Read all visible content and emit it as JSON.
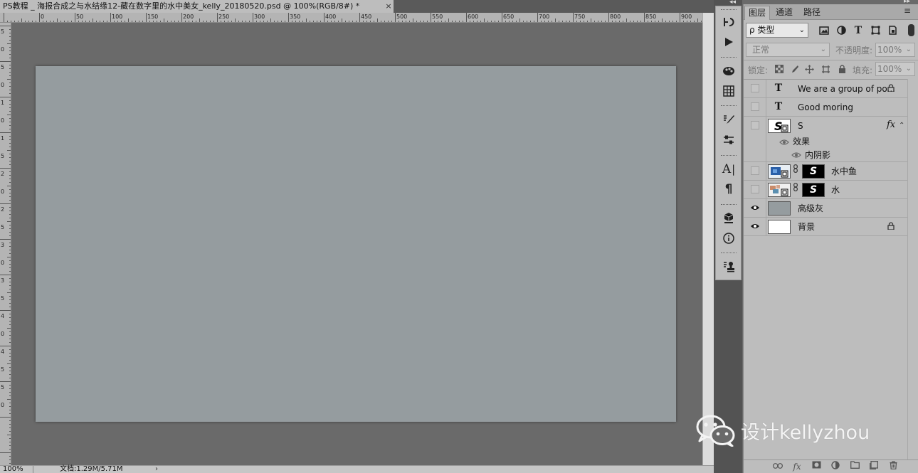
{
  "document": {
    "tab_title": "PS教程 _ 海报合成之与水结缘12-藏在数字里的水中美女_kelly_20180520.psd @ 100%(RGB/8#) *",
    "close": "×"
  },
  "ruler": {
    "top_labels": [
      "0",
      "50",
      "100",
      "150",
      "200",
      "250",
      "300",
      "350",
      "400",
      "450",
      "500",
      "550",
      "600",
      "650",
      "700",
      "750",
      "800",
      "850",
      "900"
    ],
    "left_labels": [
      "5",
      "0",
      "5",
      "0",
      "1",
      "0",
      "1",
      "5",
      "2",
      "0",
      "2",
      "5",
      "3",
      "0",
      "3",
      "5",
      "4",
      "0",
      "4",
      "5",
      "5",
      "0"
    ]
  },
  "status": {
    "zoom": "100%",
    "doc_info": "文档:1.29M/5.71M",
    "arrow": "›"
  },
  "panel": {
    "tabs": [
      "图层",
      "通道",
      "路径"
    ],
    "menu_icon": "≡",
    "filter_kind": "ρ 类型",
    "blend_mode": "正常",
    "opacity_label": "不透明度:",
    "opacity_value": "100%",
    "lock_label": "锁定:",
    "fill_label": "填充:",
    "fill_value": "100%"
  },
  "layers": [
    {
      "name": "We are a group of po...",
      "kind": "text",
      "visible": false,
      "locked": true
    },
    {
      "name": "Good moring",
      "kind": "text",
      "visible": false,
      "locked": false
    },
    {
      "name": "S",
      "kind": "smart",
      "visible": false,
      "locked": false,
      "fx": "fx"
    },
    {
      "name": "效果",
      "kind": "effects-group"
    },
    {
      "name": "内阴影",
      "kind": "effect"
    },
    {
      "name": "水中鱼",
      "kind": "masked",
      "visible": false
    },
    {
      "name": "水",
      "kind": "masked",
      "visible": false
    },
    {
      "name": "高级灰",
      "kind": "fill",
      "visible": true,
      "color": "#959c9f"
    },
    {
      "name": "背景",
      "kind": "background",
      "visible": true,
      "locked": true,
      "color": "#ffffff"
    }
  ],
  "watermark": {
    "text": "设计kellyzhou"
  },
  "colors": {
    "canvas": "#959c9f",
    "workspace": "#6a6a6a",
    "panel": "#bdbdbd"
  }
}
